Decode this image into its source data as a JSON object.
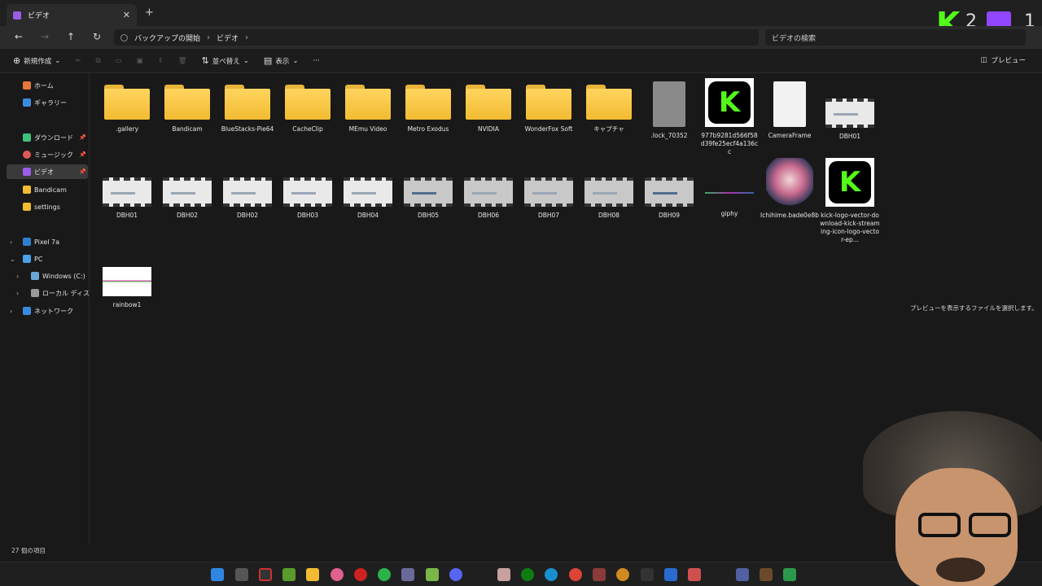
{
  "window": {
    "tab_title": "ビデオ",
    "new_tab": "+",
    "close": "✕",
    "minimize": "—",
    "maximize": "□"
  },
  "address": {
    "back": "←",
    "forward": "→",
    "up": "↑",
    "refresh": "↻",
    "crumbs": [
      "バックアップの開始",
      "ビデオ"
    ],
    "search_placeholder": "ビデオの検索"
  },
  "commands": {
    "new": "新規作成",
    "sort": "並べ替え",
    "view": "表示",
    "more": "···",
    "preview": "プレビュー"
  },
  "sidebar": {
    "items": [
      {
        "label": "ホーム"
      },
      {
        "label": "ギャラリー"
      },
      {
        "label": "ダウンロード"
      },
      {
        "label": "ミュージック"
      },
      {
        "label": "ビデオ"
      },
      {
        "label": "Bandicam"
      },
      {
        "label": "settings"
      },
      {
        "label": "Pixel 7a"
      },
      {
        "label": "PC"
      },
      {
        "label": "Windows (C:)"
      },
      {
        "label": "ローカル ディスク (D:"
      },
      {
        "label": "ネットワーク"
      }
    ]
  },
  "files": [
    {
      "name": ".gallery",
      "kind": "folder"
    },
    {
      "name": "Bandicam",
      "kind": "folder"
    },
    {
      "name": "BlueStacks-Pie64",
      "kind": "folder"
    },
    {
      "name": "CacheClip",
      "kind": "folder"
    },
    {
      "name": "MEmu Video",
      "kind": "folder"
    },
    {
      "name": "Metro Exodus",
      "kind": "folder"
    },
    {
      "name": "NVIDIA",
      "kind": "folder"
    },
    {
      "name": "WonderFox Soft",
      "kind": "folder"
    },
    {
      "name": "キャプチャ",
      "kind": "folder"
    },
    {
      "name": ".lock_70352",
      "kind": "file-gray"
    },
    {
      "name": "977b9281d566f58d39fe25ecf4a136cc",
      "kind": "kick"
    },
    {
      "name": "CameraFrame",
      "kind": "file-white"
    },
    {
      "name": "DBH01",
      "kind": "video"
    },
    {
      "name": "DBH01",
      "kind": "video"
    },
    {
      "name": "DBH02",
      "kind": "video"
    },
    {
      "name": "DBH02",
      "kind": "video"
    },
    {
      "name": "DBH03",
      "kind": "video"
    },
    {
      "name": "DBH04",
      "kind": "video"
    },
    {
      "name": "DBH05",
      "kind": "video"
    },
    {
      "name": "DBH06",
      "kind": "video"
    },
    {
      "name": "DBH07",
      "kind": "video"
    },
    {
      "name": "DBH08",
      "kind": "video"
    },
    {
      "name": "DBH09",
      "kind": "video"
    },
    {
      "name": "giphy",
      "kind": "giphy"
    },
    {
      "name": "Ichihime.bade0e8b",
      "kind": "image"
    },
    {
      "name": "kick-logo-vector-download-kick-streaming-icon-logo-vector-ep...",
      "kind": "kick"
    },
    {
      "name": "rainbow1",
      "kind": "rainbow"
    }
  ],
  "preview_message": "プレビューを表示するファイルを選択します。",
  "status": "27 個の項目",
  "overlay": {
    "kick_letter": "K",
    "count_left": "2",
    "count_right": "1"
  },
  "colors": {
    "folder": "#f2bb32",
    "kick_green": "#53fc18",
    "twitch": "#9146ff"
  }
}
